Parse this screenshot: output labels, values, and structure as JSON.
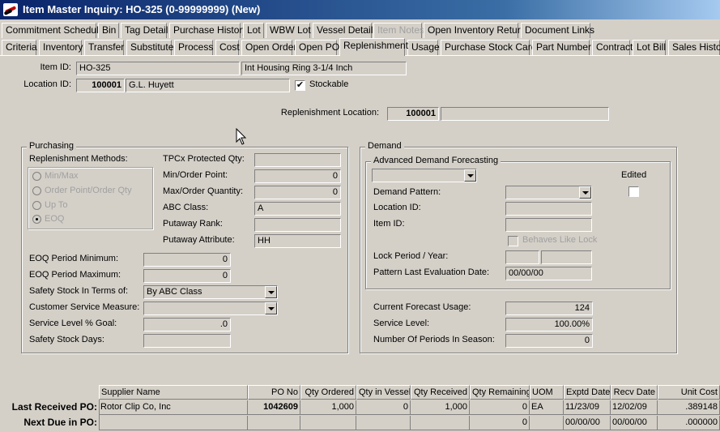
{
  "window": {
    "title": "Item Master Inquiry: HO-325 (0-99999999) (New)"
  },
  "tabs_row1": [
    {
      "label": "Commitment Schedule"
    },
    {
      "label": "Bin"
    },
    {
      "label": "Tag Detail"
    },
    {
      "label": "Purchase History"
    },
    {
      "label": "Lot"
    },
    {
      "label": "WBW Lot"
    },
    {
      "label": "Vessel Detail"
    },
    {
      "label": "Item Notes"
    },
    {
      "label": "Open Inventory Return"
    },
    {
      "label": "Document Links"
    }
  ],
  "tabs_row2": [
    {
      "label": "Criteria"
    },
    {
      "label": "Inventory"
    },
    {
      "label": "Transfer"
    },
    {
      "label": "Substitute"
    },
    {
      "label": "Process"
    },
    {
      "label": "Cost"
    },
    {
      "label": "Open Order"
    },
    {
      "label": "Open PO"
    },
    {
      "label": "Replenishment"
    },
    {
      "label": "Usage"
    },
    {
      "label": "Purchase Stock Card"
    },
    {
      "label": "Part Number"
    },
    {
      "label": "Contract"
    },
    {
      "label": "Lot Bill"
    },
    {
      "label": "Sales History"
    }
  ],
  "header": {
    "item_id_label": "Item ID:",
    "item_id": "HO-325",
    "item_desc": "Int Housing Ring 3-1/4 Inch",
    "location_id_label": "Location ID:",
    "location_id": "100001",
    "location_name": "G.L. Huyett",
    "stockable_label": "Stockable",
    "stockable_mark": "✔",
    "repl_location_label": "Replenishment Location:",
    "repl_location": "100001",
    "repl_location_name": ""
  },
  "purchasing": {
    "title": "Purchasing",
    "methods_label": "Replenishment Methods:",
    "methods": [
      "Min/Max",
      "Order Point/Order Qty",
      "Up To",
      "EOQ"
    ],
    "tpcx_label": "TPCx Protected Qty:",
    "tpcx": "",
    "min_order_label": "Min/Order Point:",
    "min_order": "0",
    "max_order_label": "Max/Order Quantity:",
    "max_order": "0",
    "abc_label": "ABC Class:",
    "abc": "A",
    "putaway_rank_label": "Putaway Rank:",
    "putaway_rank": "",
    "putaway_attr_label": "Putaway Attribute:",
    "putaway_attr": "HH",
    "eoq_min_label": "EOQ Period Minimum:",
    "eoq_min": "0",
    "eoq_max_label": "EOQ Period Maximum:",
    "eoq_max": "0",
    "safety_terms_label": "Safety Stock In Terms of:",
    "safety_terms": "By ABC Class",
    "csm_label": "Customer Service Measure:",
    "csm": "",
    "service_goal_label": "Service Level % Goal:",
    "service_goal": ".0",
    "safety_days_label": "Safety Stock Days:",
    "safety_days": ""
  },
  "demand": {
    "title": "Demand",
    "adf_title": "Advanced Demand Forecasting",
    "adf_select": "",
    "edited_label": "Edited",
    "pattern_label": "Demand Pattern:",
    "pattern": "",
    "loc_label": "Location ID:",
    "loc": "",
    "item_label": "Item ID:",
    "item": "",
    "behaves_label": "Behaves Like Lock",
    "lock_label": "Lock Period / Year:",
    "lock_period": "",
    "lock_year": "",
    "last_eval_label": "Pattern Last Evaluation Date:",
    "last_eval": "00/00/00",
    "forecast_label": "Current Forecast Usage:",
    "forecast": "124",
    "service_label": "Service Level:",
    "service": "100.00%",
    "periods_label": "Number Of Periods In Season:",
    "periods": "0"
  },
  "po_grid": {
    "columns": [
      "Supplier Name",
      "PO No",
      "Qty Ordered",
      "Qty in Vessel",
      "Qty Received",
      "Qty Remaining",
      "UOM",
      "Exptd Date",
      "Recv Date",
      "Unit Cost"
    ],
    "rows": [
      {
        "label": "Last Received PO:",
        "cells": [
          "Rotor Clip Co, Inc",
          "1042609",
          "1,000",
          "0",
          "1,000",
          "0",
          "EA",
          "11/23/09",
          "12/02/09",
          ".389148"
        ]
      },
      {
        "label": "Next Due in PO:",
        "cells": [
          "",
          "",
          "",
          "",
          "",
          "0",
          "",
          "00/00/00",
          "00/00/00",
          ".000000"
        ]
      }
    ]
  }
}
